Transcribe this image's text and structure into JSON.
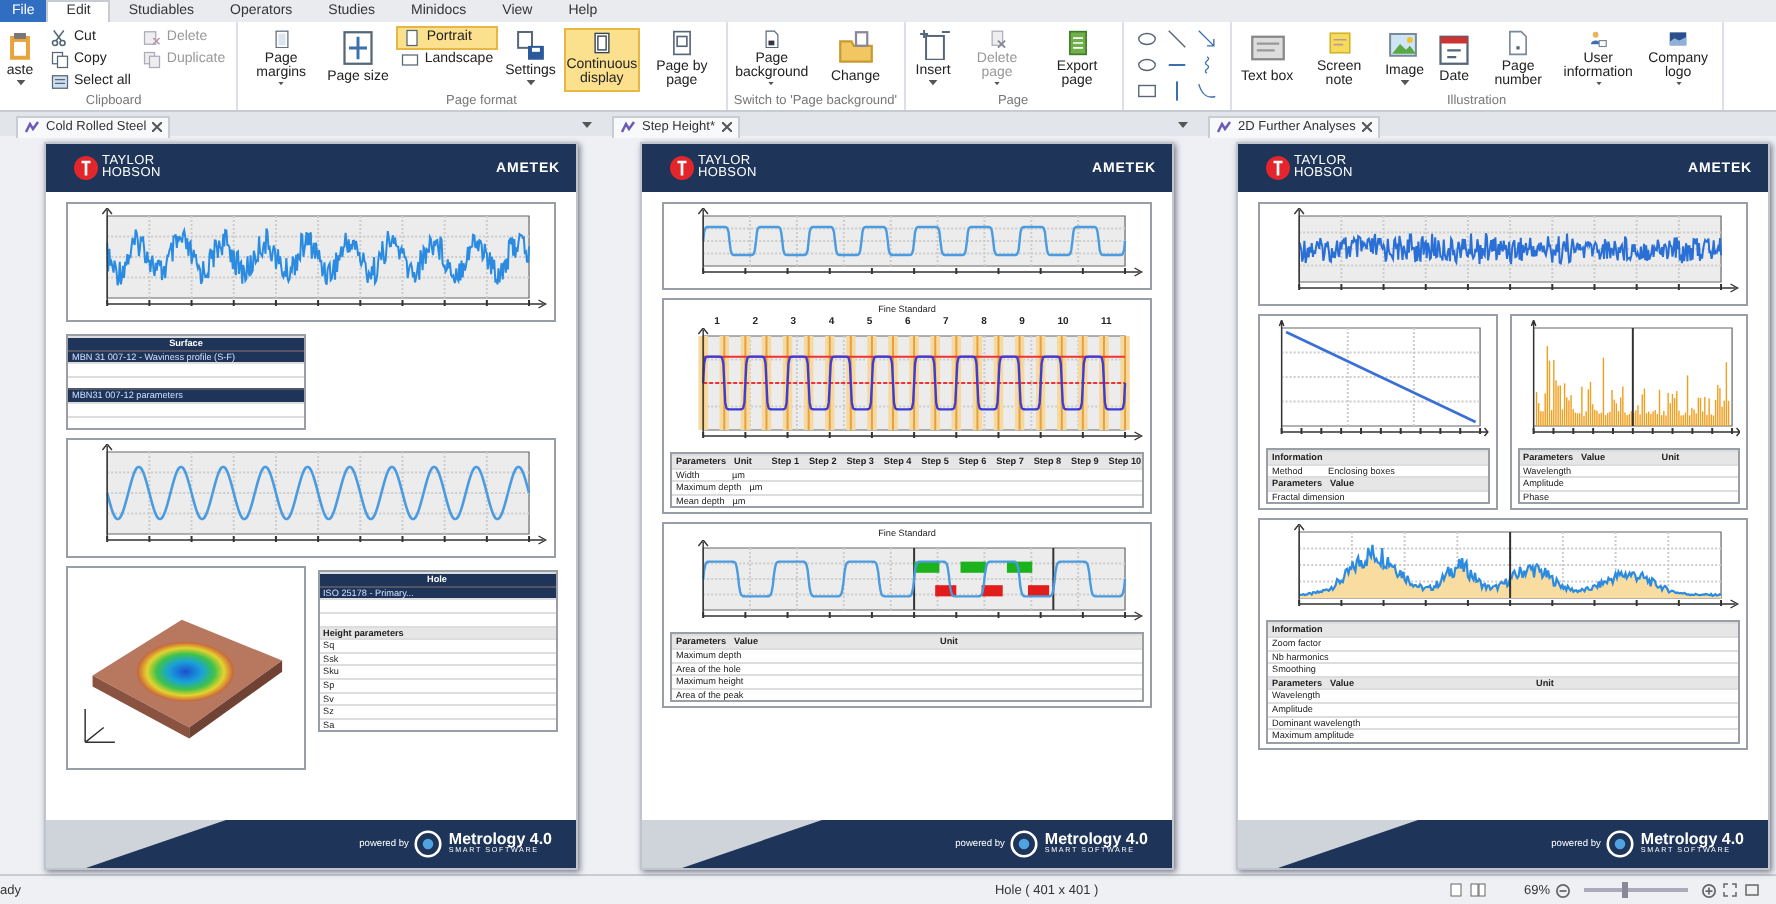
{
  "ribbon": {
    "tabs": [
      {
        "label": "File",
        "kind": "file",
        "selected": false
      },
      {
        "label": "Edit",
        "kind": "tab",
        "selected": true
      },
      {
        "label": "Studiables",
        "kind": "tab",
        "selected": false
      },
      {
        "label": "Operators",
        "kind": "tab",
        "selected": false
      },
      {
        "label": "Studies",
        "kind": "tab",
        "selected": false
      },
      {
        "label": "Minidocs",
        "kind": "tab",
        "selected": false
      },
      {
        "label": "View",
        "kind": "tab",
        "selected": false
      },
      {
        "label": "Help",
        "kind": "tab",
        "selected": false
      }
    ],
    "groups": [
      {
        "kind": "buttons",
        "label": "Clipboard",
        "buttons": [
          {
            "kind": "large",
            "label": "aste",
            "dropdown": true,
            "disabled": false
          },
          {
            "kind": "small",
            "label": "Cut",
            "disabled": false
          },
          {
            "kind": "small",
            "label": "Copy",
            "disabled": false
          },
          {
            "kind": "small",
            "label": "Select all",
            "disabled": false
          },
          {
            "kind": "small",
            "label": "Delete",
            "disabled": true
          },
          {
            "kind": "small",
            "label": "Duplicate",
            "disabled": true
          },
          {
            "kind": "spacer"
          }
        ]
      },
      {
        "kind": "buttons",
        "label": "Page format",
        "buttons": [
          {
            "kind": "large",
            "label": "Page margins",
            "dropdown": true,
            "disabled": false
          },
          {
            "kind": "large",
            "label": "Page size",
            "disabled": false
          },
          {
            "kind": "small",
            "label": "Portrait",
            "disabled": false,
            "selected": true
          },
          {
            "kind": "small",
            "label": "Landscape",
            "disabled": false,
            "selected": false
          },
          {
            "kind": "spacer"
          },
          {
            "kind": "large",
            "label": "Settings",
            "dropdown": true,
            "disabled": false
          },
          {
            "kind": "large",
            "label": "Continuous display",
            "disabled": false,
            "selected": true
          },
          {
            "kind": "large",
            "label": "Page by page",
            "disabled": false,
            "selected": false
          }
        ]
      },
      {
        "kind": "buttons",
        "label": "Switch to 'Page background'",
        "buttons": [
          {
            "kind": "large",
            "label": "Page background",
            "dropdown": true,
            "disabled": false
          },
          {
            "kind": "large",
            "label": "Change",
            "disabled": false
          }
        ]
      },
      {
        "kind": "buttons",
        "label": "Page",
        "buttons": [
          {
            "kind": "large",
            "label": "Insert",
            "dropdown": true,
            "disabled": false
          },
          {
            "kind": "large",
            "label": "Delete page",
            "dropdown": true,
            "disabled": true
          },
          {
            "kind": "large",
            "label": "Export page",
            "disabled": false
          }
        ]
      },
      {
        "kind": "shapes"
      },
      {
        "kind": "buttons",
        "label": "Illustration",
        "buttons": [
          {
            "kind": "large",
            "label": "Text box",
            "disabled": false
          },
          {
            "kind": "large",
            "label": "Screen note",
            "disabled": false
          },
          {
            "kind": "large",
            "label": "Image",
            "dropdown": true,
            "disabled": false
          },
          {
            "kind": "large",
            "label": "Date",
            "disabled": false
          },
          {
            "kind": "large",
            "label": "Page number",
            "disabled": false
          },
          {
            "kind": "large",
            "label": "User information",
            "dropdown": true,
            "disabled": false
          },
          {
            "kind": "large",
            "label": "Company logo",
            "dropdown": true,
            "disabled": false
          }
        ]
      }
    ]
  },
  "documents": [
    {
      "tab": "Cold Rolled Steel",
      "header": {
        "brand": [
          "TAYLOR",
          "HOBSON"
        ],
        "partner": "AMETEK"
      },
      "blocks": [
        {
          "kind": "chart"
        },
        {
          "kind": "table",
          "rows": [
            {
              "kind": "title",
              "cells": [
                "Surface"
              ]
            },
            {
              "kind": "subtitle",
              "cells": [
                "MBN 31 007-12 - Waviness profile (S-F)"
              ]
            },
            {
              "kind": "row",
              "cells": [
                ""
              ]
            },
            {
              "kind": "row",
              "cells": [
                ""
              ]
            },
            {
              "kind": "subtitle",
              "cells": [
                "MBN31 007-12 parameters"
              ]
            },
            {
              "kind": "row",
              "cells": [
                ""
              ]
            },
            {
              "kind": "row",
              "cells": [
                ""
              ]
            }
          ]
        },
        {
          "kind": "chart"
        },
        {
          "kind": "row",
          "items": [
            {
              "kind": "chart"
            },
            {
              "kind": "table",
              "rows": [
                {
                  "kind": "title",
                  "cells": [
                    "Hole"
                  ]
                },
                {
                  "kind": "subtitle",
                  "cells": [
                    "ISO 25178 - Primary..."
                  ]
                },
                {
                  "kind": "row",
                  "cells": [
                    ""
                  ]
                },
                {
                  "kind": "row",
                  "cells": [
                    ""
                  ]
                },
                {
                  "kind": "head",
                  "cells": [
                    "Height parameters"
                  ]
                },
                {
                  "kind": "row",
                  "cells": [
                    "Sq"
                  ]
                },
                {
                  "kind": "row",
                  "cells": [
                    "Ssk"
                  ]
                },
                {
                  "kind": "row",
                  "cells": [
                    "Sku"
                  ]
                },
                {
                  "kind": "row",
                  "cells": [
                    "Sp"
                  ]
                },
                {
                  "kind": "row",
                  "cells": [
                    "Sv"
                  ]
                },
                {
                  "kind": "row",
                  "cells": [
                    "Sz"
                  ]
                },
                {
                  "kind": "row",
                  "cells": [
                    "Sa"
                  ]
                }
              ]
            }
          ]
        }
      ],
      "footer": {
        "powered_by": "powered by",
        "product": "Metrology 4.0",
        "tagline": "SMART SOFTWARE"
      }
    },
    {
      "tab": "Step Height*",
      "header": {
        "brand": [
          "TAYLOR",
          "HOBSON"
        ],
        "partner": "AMETEK"
      },
      "blocks": [
        {
          "kind": "chart"
        },
        {
          "kind": "chart",
          "title": "Fine Standard",
          "step_labels": [
            "1",
            "2",
            "3",
            "4",
            "5",
            "6",
            "7",
            "8",
            "9",
            "10",
            "11"
          ],
          "table": [
            {
              "kind": "head",
              "cells": [
                "Parameters",
                "Unit",
                "Step 1",
                "Step 2",
                "Step 3",
                "Step 4",
                "Step 5",
                "Step 6",
                "Step 7",
                "Step 8",
                "Step 9",
                "Step 10"
              ]
            },
            {
              "kind": "row",
              "cells": [
                "Width",
                "µm"
              ]
            },
            {
              "kind": "row",
              "cells": [
                "Maximum depth",
                "µm"
              ]
            },
            {
              "kind": "row",
              "cells": [
                "Mean depth",
                "µm"
              ]
            }
          ]
        },
        {
          "kind": "chart",
          "title": "Fine Standard",
          "table": [
            {
              "kind": "head",
              "cells": [
                "Parameters",
                "Value",
                "Unit"
              ]
            },
            {
              "kind": "row",
              "cells": [
                "Maximum depth"
              ]
            },
            {
              "kind": "row",
              "cells": [
                "Area of the hole"
              ]
            },
            {
              "kind": "row",
              "cells": [
                "Maximum height"
              ]
            },
            {
              "kind": "row",
              "cells": [
                "Area of the peak"
              ]
            }
          ]
        }
      ],
      "footer": {
        "powered_by": "powered by",
        "product": "Metrology 4.0",
        "tagline": "SMART SOFTWARE"
      }
    },
    {
      "tab": "2D Further Analyses",
      "header": {
        "brand": [
          "TAYLOR",
          "HOBSON"
        ],
        "partner": "AMETEK"
      },
      "blocks": [
        {
          "kind": "chart"
        },
        {
          "kind": "row",
          "items": [
            {
              "kind": "chart",
              "table": [
                {
                  "kind": "head",
                  "cells": [
                    "Information"
                  ]
                },
                {
                  "kind": "row",
                  "cells": [
                    "Method",
                    "Enclosing boxes"
                  ]
                },
                {
                  "kind": "head",
                  "cells": [
                    "Parameters",
                    "Value"
                  ]
                },
                {
                  "kind": "row",
                  "cells": [
                    "Fractal dimension"
                  ]
                }
              ]
            },
            {
              "kind": "chart",
              "table": [
                {
                  "kind": "head",
                  "cells": [
                    "Parameters",
                    "Value",
                    "Unit"
                  ]
                },
                {
                  "kind": "row",
                  "cells": [
                    "Wavelength"
                  ]
                },
                {
                  "kind": "row",
                  "cells": [
                    "Amplitude"
                  ]
                },
                {
                  "kind": "row",
                  "cells": [
                    "Phase"
                  ]
                }
              ]
            }
          ]
        },
        {
          "kind": "chart",
          "table": [
            {
              "kind": "head",
              "cells": [
                "Information"
              ]
            },
            {
              "kind": "row",
              "cells": [
                "Zoom factor"
              ]
            },
            {
              "kind": "row",
              "cells": [
                "Nb harmonics"
              ]
            },
            {
              "kind": "row",
              "cells": [
                "Smoothing"
              ]
            },
            {
              "kind": "head",
              "cells": [
                "Parameters",
                "Value",
                "Unit"
              ]
            },
            {
              "kind": "row",
              "cells": [
                "Wavelength"
              ]
            },
            {
              "kind": "row",
              "cells": [
                "Amplitude"
              ]
            },
            {
              "kind": "row",
              "cells": [
                "Dominant wavelength"
              ]
            },
            {
              "kind": "row",
              "cells": [
                "Maximum amplitude"
              ]
            }
          ]
        }
      ],
      "footer": {
        "powered_by": "powered by",
        "product": "Metrology 4.0",
        "tagline": "SMART SOFTWARE"
      }
    }
  ],
  "status_bar": {
    "status": "ady",
    "selection": "Hole ( 401 x 401 )",
    "zoom": "69%",
    "zoom_slider": {
      "level": 0.4
    }
  }
}
